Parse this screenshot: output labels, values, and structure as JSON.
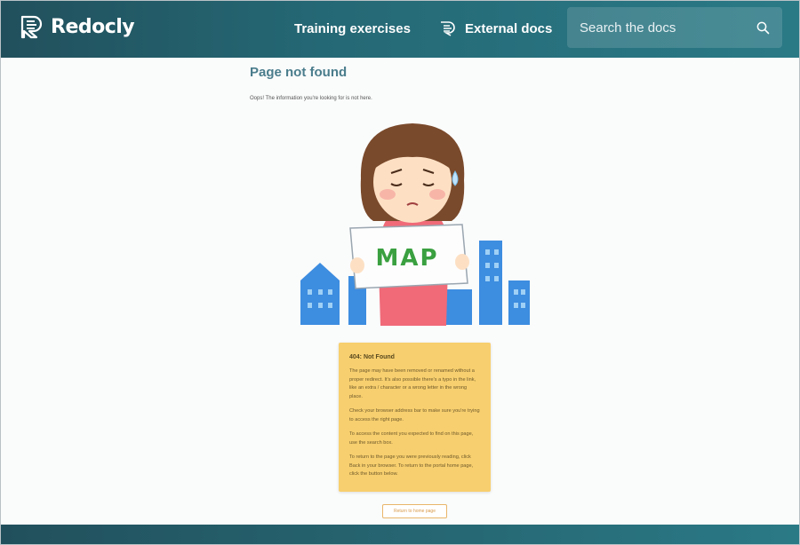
{
  "header": {
    "brand": "Redocly",
    "nav": {
      "training": "Training exercises",
      "external": "External docs"
    },
    "search": {
      "placeholder": "Search the docs",
      "value": ""
    }
  },
  "main": {
    "title": "Page not found",
    "subtitle": "Oops! The information you're looking for is not here.",
    "illustration": {
      "sign_text": "MAP"
    },
    "notice": {
      "heading": "404: Not Found",
      "paragraphs": [
        "The page may have been removed or renamed without a proper redirect. It's also possible there's a typo in the link, like an extra / character or a wrong letter in the wrong place.",
        "Check your browser address bar to make sure you're trying to access the right page.",
        "To access the content you expected to find on this page, use the search box.",
        "To return to the page you were previously reading, click Back in your browser. To return to the portal home page, click the button below."
      ]
    },
    "home_button": "Return to home page"
  },
  "colors": {
    "header_dark": "#21505c",
    "header_light": "#2a7a86",
    "notice_bg": "#f7cf6e",
    "title": "#4a7d8c",
    "button_border": "#e9b66a"
  },
  "icons": {
    "logo": "redocly-logo-icon",
    "external": "external-docs-icon",
    "search": "search-icon"
  }
}
